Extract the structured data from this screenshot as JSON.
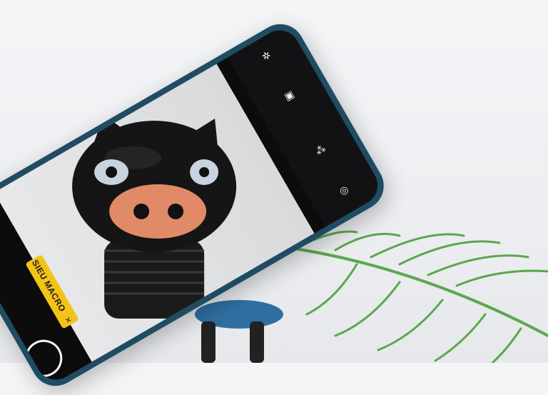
{
  "camera": {
    "macro_label": "SIEU MACRO",
    "macro_close": "×"
  },
  "icons": {
    "flash": "flash-icon",
    "ratio": "aspect-ratio-icon",
    "filter": "filter-icon",
    "settings": "settings-icon",
    "shutter": "shutter-button-icon"
  },
  "colors": {
    "phone_body": "#1f4c63",
    "badge": "#f4c319",
    "pig_body": "#151515",
    "pig_nose": "#e08a68",
    "leaf": "#5aa84d"
  }
}
